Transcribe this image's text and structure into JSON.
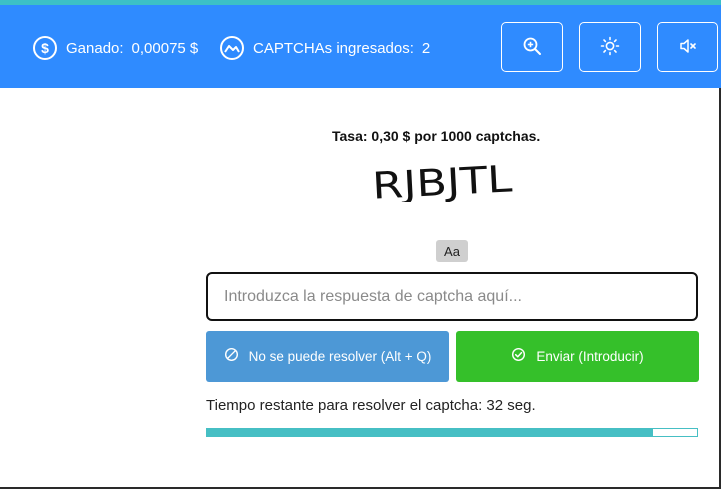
{
  "header": {
    "earned_label": "Ganado:",
    "earned_value": "0,00075 $",
    "count_label": "CAPTCHAs ingresados:",
    "count_value": "2",
    "icons": [
      "dollar-circle-icon",
      "image-circle-icon",
      "zoom-in-icon",
      "brightness-icon",
      "mute-icon"
    ]
  },
  "rate_text": "Tasa: 0,30 $ por 1000 captchas.",
  "captcha": {
    "text": "RJBJTL"
  },
  "case_badge": "Aa",
  "answer": {
    "placeholder": "Introduzca la respuesta de captcha aquí...",
    "value": ""
  },
  "buttons": {
    "skip_label": "No se puede resolver (Alt + Q)",
    "submit_label": "Enviar (Introducir)"
  },
  "timer": {
    "text": "Tiempo restante para resolver el captcha: 32 seg.",
    "progress_fraction": 0.91
  },
  "colors": {
    "header_bg": "#2f8bff",
    "top_strip": "#3cc0c6",
    "skip_button": "#4d98d6",
    "submit_button": "#35c02a",
    "progress": "#46bfc4"
  }
}
